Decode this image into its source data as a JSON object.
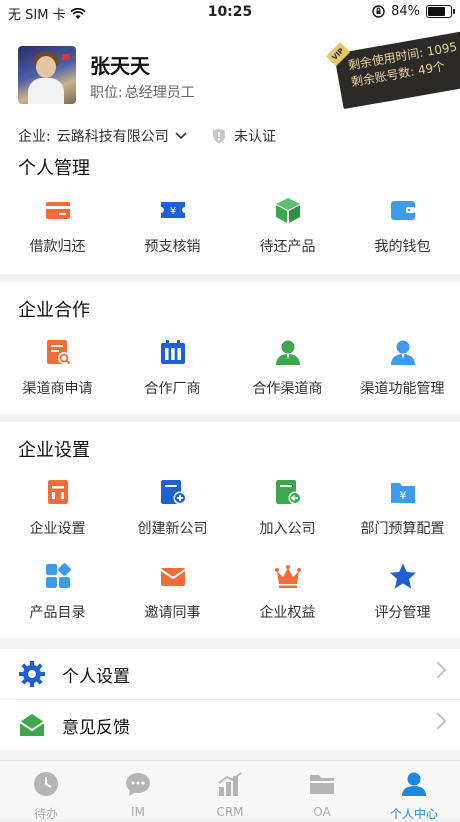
{
  "status_bar": {
    "carrier": "无 SIM 卡",
    "time": "10:25",
    "battery_text": "84%",
    "battery_level": 0.84
  },
  "profile": {
    "name": "张天天",
    "position_label": "职位:",
    "position_value": "总经理员工",
    "company_label": "企业:",
    "company_name": "云路科技有限公司",
    "verify_status": "未认证"
  },
  "vip_card": {
    "tag": "VIP",
    "line1": "剩余使用时间: 1095",
    "line2": "剩余账号数: 49个"
  },
  "sections": {
    "personal": {
      "title": "个人管理",
      "items": [
        {
          "label": "借款归还",
          "icon": "loan-return-icon",
          "color": "#f26b3a"
        },
        {
          "label": "预支核销",
          "icon": "advance-writeoff-icon",
          "color": "#1a62d6"
        },
        {
          "label": "待还产品",
          "icon": "pending-product-icon",
          "color": "#3aa84b"
        },
        {
          "label": "我的钱包",
          "icon": "wallet-icon",
          "color": "#3c9bea"
        }
      ]
    },
    "cooperation": {
      "title": "企业合作",
      "items": [
        {
          "label": "渠道商申请",
          "icon": "channel-apply-icon",
          "color": "#f26b3a"
        },
        {
          "label": "合作厂商",
          "icon": "partner-vendor-icon",
          "color": "#1a62d6"
        },
        {
          "label": "合作渠道商",
          "icon": "partner-channel-icon",
          "color": "#3aa84b"
        },
        {
          "label": "渠道功能管理",
          "icon": "channel-function-icon",
          "color": "#3c9bea"
        }
      ]
    },
    "settings": {
      "title": "企业设置",
      "items": [
        {
          "label": "企业设置",
          "icon": "company-settings-icon",
          "color": "#f26b3a"
        },
        {
          "label": "创建新公司",
          "icon": "create-company-icon",
          "color": "#1a62d6"
        },
        {
          "label": "加入公司",
          "icon": "join-company-icon",
          "color": "#3aa84b"
        },
        {
          "label": "部门预算配置",
          "icon": "budget-config-icon",
          "color": "#3c9bea"
        },
        {
          "label": "产品目录",
          "icon": "product-catalog-icon",
          "color": "#3c9bea"
        },
        {
          "label": "邀请同事",
          "icon": "invite-colleague-icon",
          "color": "#f26b3a"
        },
        {
          "label": "企业权益",
          "icon": "crown-icon",
          "color": "#f26b3a"
        },
        {
          "label": "评分管理",
          "icon": "star-icon",
          "color": "#1a62d6"
        }
      ]
    }
  },
  "list": {
    "personal_settings": "个人设置",
    "feedback": "意见反馈"
  },
  "tabbar": [
    {
      "label": "待办",
      "icon": "clock-icon",
      "active": false
    },
    {
      "label": "IM",
      "icon": "chat-icon",
      "active": false
    },
    {
      "label": "CRM",
      "icon": "bar-chart-icon",
      "active": false
    },
    {
      "label": "OA",
      "icon": "folder-icon",
      "active": false
    },
    {
      "label": "个人中心",
      "icon": "user-icon",
      "active": true
    }
  ],
  "colors": {
    "accent": "#1e88e5",
    "inactive": "#aaaaaa",
    "vip_bg": "#2c2a28",
    "vip_text": "#e8d39a"
  }
}
